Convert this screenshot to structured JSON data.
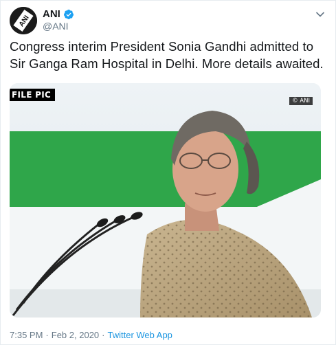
{
  "tweet": {
    "author": {
      "display_name": "ANI",
      "handle": "@ANI",
      "avatar_label": "ANI",
      "verified": true
    },
    "text": "Congress interim President Sonia Gandhi admitted to\nSir Ganga Ram Hospital in Delhi. More details awaited.",
    "media": {
      "badge": "FILE PIC",
      "watermark": "© ANI"
    },
    "meta": {
      "time": "7:35 PM",
      "separator": "·",
      "date": "Feb 2, 2020",
      "separator2": "·",
      "source": "Twitter Web App"
    }
  },
  "colors": {
    "link": "#1b95e0",
    "verified": "#1da1f2",
    "secondary_text": "#657786"
  },
  "icons": {
    "verified": "verified-badge-icon",
    "caret": "chevron-down-icon"
  }
}
